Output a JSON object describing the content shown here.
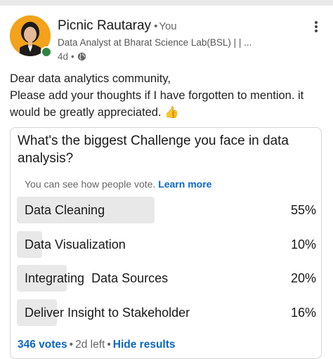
{
  "post": {
    "author": "Picnic Rautaray",
    "you_badge": "You",
    "headline": "Data Analyst at Bharat Science Lab(BSL) | | ...",
    "time": "4d",
    "body_lines": [
      "Dear data analytics community,",
      "Please add your thoughts if I have forgotten to mention. it",
      "would be greatly appreciated. 👍"
    ]
  },
  "poll": {
    "question": "What's the biggest Challenge you face in data analysis?",
    "visibility_text": "You can see how people vote.",
    "learn_more": "Learn more",
    "options": [
      {
        "label": "Data Cleaning",
        "percent": "55%",
        "fraction": 0.55
      },
      {
        "label": "Data Visualization",
        "percent": "10%",
        "fraction": 0.1
      },
      {
        "label": "Integrating  Data Sources",
        "percent": "20%",
        "fraction": 0.2
      },
      {
        "label": "Deliver Insight to Stakeholder",
        "percent": "16%",
        "fraction": 0.16
      }
    ],
    "votes": "346 votes",
    "time_left": "2d left",
    "hide_results": "Hide results"
  },
  "colors": {
    "link": "#0a66c2",
    "avatar_bg": "#f3a21a",
    "online": "#2e8540",
    "bar": "#e8e8e8"
  }
}
